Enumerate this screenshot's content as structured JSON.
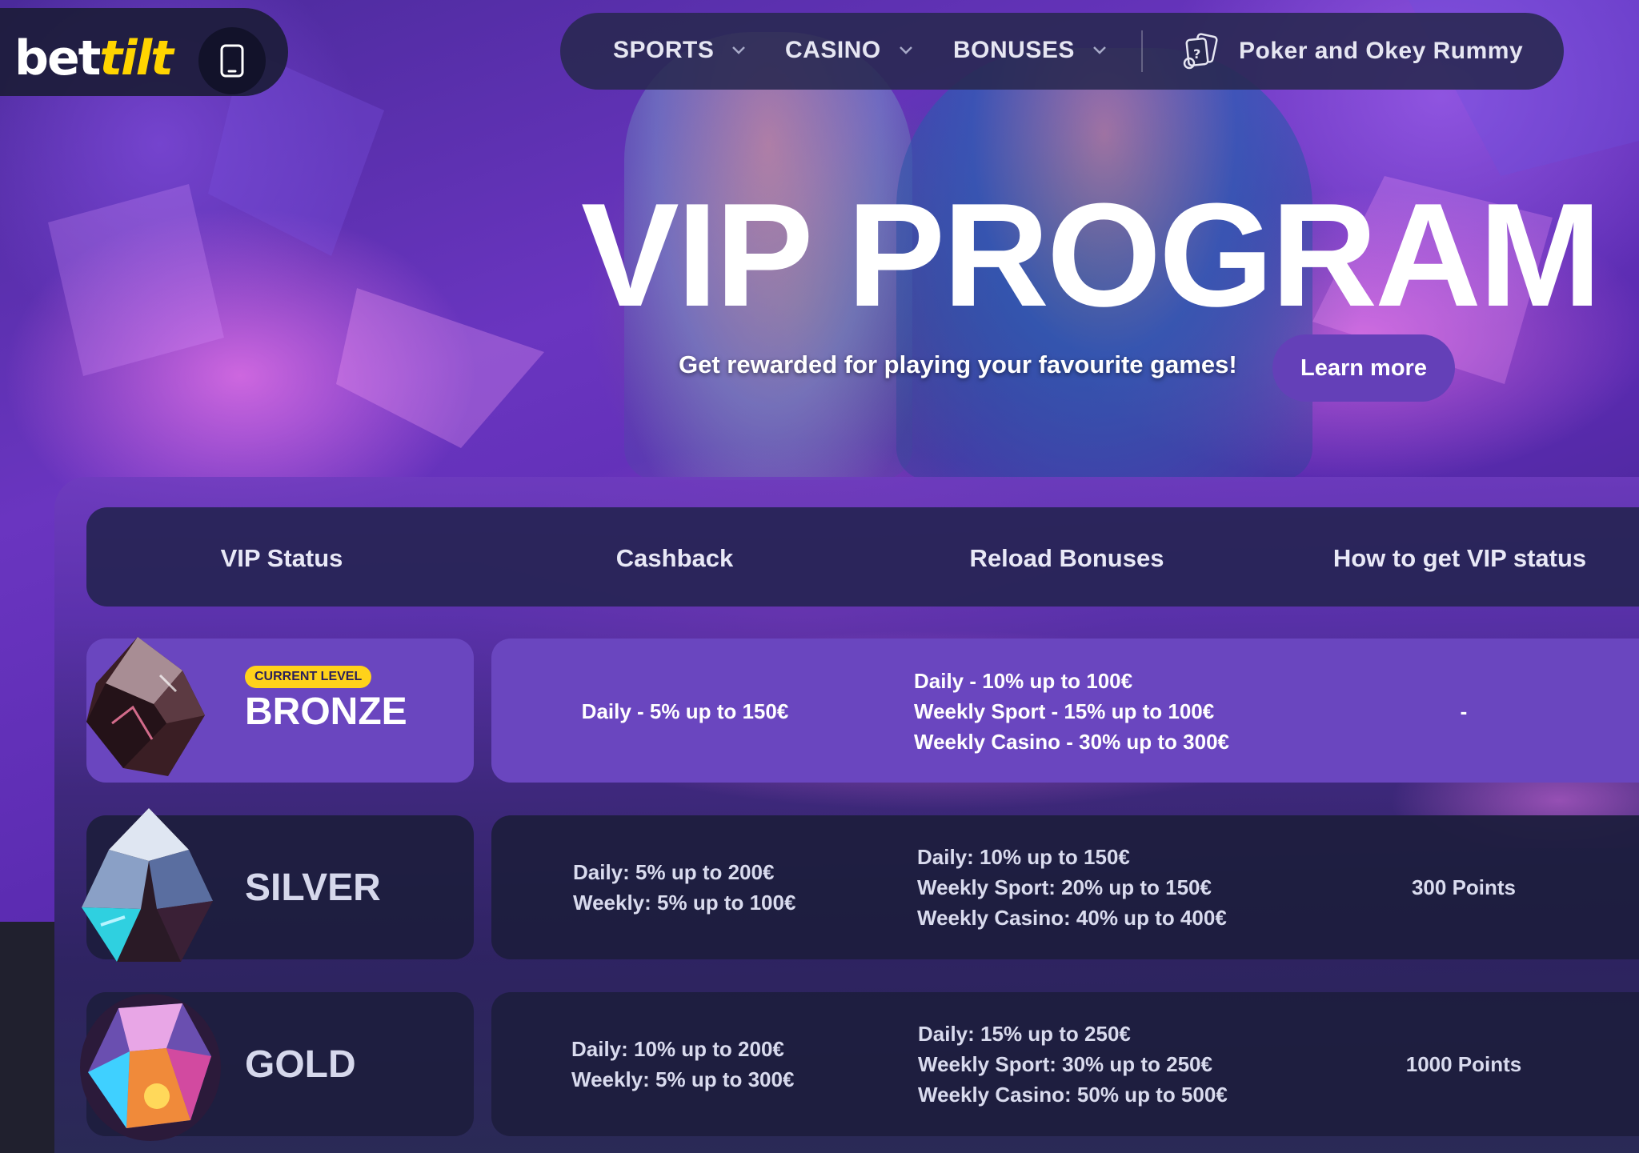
{
  "brand": {
    "logo_part1": "bet",
    "logo_part2": "tilt"
  },
  "nav": {
    "items": [
      {
        "label": "SPORTS"
      },
      {
        "label": "CASINO"
      },
      {
        "label": "BONUSES"
      }
    ],
    "poker_label": "Poker and Okey Rummy"
  },
  "hero": {
    "title": "VIP PROGRAM",
    "subtitle": "Get rewarded for playing your favourite games!",
    "cta": "Learn more"
  },
  "table": {
    "headers": [
      "VIP Status",
      "Cashback",
      "Reload Bonuses",
      "How to get VIP status"
    ],
    "current_badge": "CURRENT LEVEL",
    "rows": [
      {
        "tier": "BRONZE",
        "cashback": [
          "Daily - 5% up to 150€"
        ],
        "reload": [
          "Daily - 10% up to 100€",
          "Weekly Sport - 15% up to 100€",
          "Weekly Casino - 30% up to 300€"
        ],
        "requirement": "-"
      },
      {
        "tier": "SILVER",
        "cashback": [
          "Daily: 5% up to 200€",
          "Weekly: 5% up to 100€"
        ],
        "reload": [
          "Daily: 10% up to 150€",
          "Weekly Sport: 20% up to 150€",
          "Weekly Casino: 40% up to 400€"
        ],
        "requirement": "300 Points"
      },
      {
        "tier": "GOLD",
        "cashback": [
          "Daily: 10% up to 200€",
          "Weekly: 5% up to 300€"
        ],
        "reload": [
          "Daily: 15% up to 250€",
          "Weekly Sport: 30% up to 250€",
          "Weekly Casino: 50% up to 500€"
        ],
        "requirement": "1000 Points"
      }
    ]
  },
  "colors": {
    "accent": "#6440b8",
    "highlight_row": "#6a46bf",
    "badge_yellow": "#ffd21a",
    "logo_yellow": "#ffd400"
  },
  "icons": {
    "mobile": "mobile-phone-icon",
    "chevron": "chevron-down-icon",
    "poker": "poker-cards-icon"
  }
}
